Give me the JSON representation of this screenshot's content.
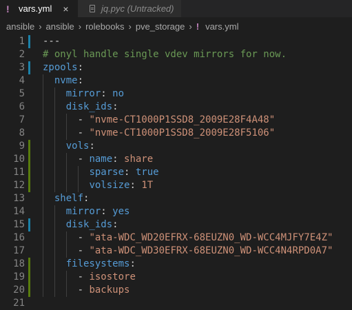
{
  "tabs": [
    {
      "label": "vars.yml",
      "icon": "yaml-exclamation-icon",
      "active": true,
      "close": "×"
    },
    {
      "label": "jq.pyc (Untracked)",
      "icon": "file-icon",
      "active": false
    }
  ],
  "breadcrumb": {
    "items": [
      "ansible",
      "ansible",
      "rolebooks",
      "pve_storage"
    ],
    "file": "vars.yml",
    "separator": "›"
  },
  "editor": {
    "lines": [
      {
        "n": "1",
        "gutter": "mod",
        "indent": 0,
        "tokens": [
          {
            "t": "---",
            "c": "d"
          }
        ]
      },
      {
        "n": "2",
        "gutter": "",
        "indent": 0,
        "tokens": [
          {
            "t": "# onyl handle single vdev mirrors for now.",
            "c": "c"
          }
        ]
      },
      {
        "n": "3",
        "gutter": "mod",
        "indent": 0,
        "tokens": [
          {
            "t": "zpools",
            "c": "k"
          },
          {
            "t": ":",
            "c": "p"
          }
        ]
      },
      {
        "n": "4",
        "gutter": "",
        "indent": 1,
        "tokens": [
          {
            "t": "nvme",
            "c": "k"
          },
          {
            "t": ":",
            "c": "p"
          }
        ]
      },
      {
        "n": "5",
        "gutter": "",
        "indent": 2,
        "tokens": [
          {
            "t": "mirror",
            "c": "k"
          },
          {
            "t": ": ",
            "c": "p"
          },
          {
            "t": "no",
            "c": "k"
          }
        ]
      },
      {
        "n": "6",
        "gutter": "",
        "indent": 2,
        "tokens": [
          {
            "t": "disk_ids",
            "c": "k"
          },
          {
            "t": ":",
            "c": "p"
          }
        ]
      },
      {
        "n": "7",
        "gutter": "",
        "indent": 3,
        "tokens": [
          {
            "t": "- ",
            "c": "p"
          },
          {
            "t": "\"nvme-CT1000P1SSD8_2009E28F4A48\"",
            "c": "s"
          }
        ]
      },
      {
        "n": "8",
        "gutter": "",
        "indent": 3,
        "tokens": [
          {
            "t": "- ",
            "c": "p"
          },
          {
            "t": "\"nvme-CT1000P1SSD8_2009E28F5106\"",
            "c": "s"
          }
        ]
      },
      {
        "n": "9",
        "gutter": "add",
        "indent": 2,
        "tokens": [
          {
            "t": "vols",
            "c": "k"
          },
          {
            "t": ":",
            "c": "p"
          }
        ]
      },
      {
        "n": "10",
        "gutter": "add",
        "indent": 3,
        "tokens": [
          {
            "t": "- ",
            "c": "p"
          },
          {
            "t": "name",
            "c": "k"
          },
          {
            "t": ": ",
            "c": "p"
          },
          {
            "t": "share",
            "c": "s"
          }
        ]
      },
      {
        "n": "11",
        "gutter": "add",
        "indent": 4,
        "tokens": [
          {
            "t": "sparse",
            "c": "k"
          },
          {
            "t": ": ",
            "c": "p"
          },
          {
            "t": "true",
            "c": "k"
          }
        ]
      },
      {
        "n": "12",
        "gutter": "add",
        "indent": 4,
        "tokens": [
          {
            "t": "volsize",
            "c": "k"
          },
          {
            "t": ": ",
            "c": "p"
          },
          {
            "t": "1T",
            "c": "s"
          }
        ]
      },
      {
        "n": "13",
        "gutter": "",
        "indent": 1,
        "tokens": [
          {
            "t": "shelf",
            "c": "k"
          },
          {
            "t": ":",
            "c": "p"
          }
        ]
      },
      {
        "n": "14",
        "gutter": "",
        "indent": 2,
        "tokens": [
          {
            "t": "mirror",
            "c": "k"
          },
          {
            "t": ": ",
            "c": "p"
          },
          {
            "t": "yes",
            "c": "k"
          }
        ]
      },
      {
        "n": "15",
        "gutter": "mod",
        "indent": 2,
        "tokens": [
          {
            "t": "disk_ids",
            "c": "k"
          },
          {
            "t": ":",
            "c": "p"
          }
        ]
      },
      {
        "n": "16",
        "gutter": "",
        "indent": 3,
        "tokens": [
          {
            "t": "- ",
            "c": "p"
          },
          {
            "t": "\"ata-WDC_WD20EFRX-68EUZN0_WD-WCC4MJFY7E4Z\"",
            "c": "s"
          }
        ]
      },
      {
        "n": "17",
        "gutter": "",
        "indent": 3,
        "tokens": [
          {
            "t": "- ",
            "c": "p"
          },
          {
            "t": "\"ata-WDC_WD30EFRX-68EUZN0_WD-WCC4N4RPD0A7\"",
            "c": "s"
          }
        ]
      },
      {
        "n": "18",
        "gutter": "add",
        "indent": 2,
        "tokens": [
          {
            "t": "filesystems",
            "c": "k"
          },
          {
            "t": ":",
            "c": "p"
          }
        ]
      },
      {
        "n": "19",
        "gutter": "add",
        "indent": 3,
        "tokens": [
          {
            "t": "- ",
            "c": "p"
          },
          {
            "t": "isostore",
            "c": "s"
          }
        ]
      },
      {
        "n": "20",
        "gutter": "add",
        "indent": 3,
        "tokens": [
          {
            "t": "- ",
            "c": "p"
          },
          {
            "t": "backups",
            "c": "s"
          }
        ]
      },
      {
        "n": "21",
        "gutter": "",
        "indent": 0,
        "tokens": []
      }
    ]
  },
  "colors": {
    "background": "#1e1e1e",
    "key": "#569cd6",
    "string": "#ce9178",
    "comment": "#6a9955",
    "gutter_modified": "#1b81a8",
    "gutter_added": "#587c0c"
  }
}
